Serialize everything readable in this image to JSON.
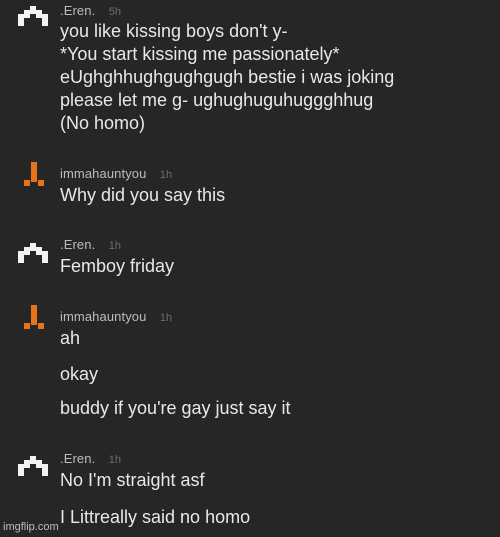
{
  "messages": [
    {
      "author": ".Eren.",
      "avatar_icon": "space-invader-icon",
      "time": "5h",
      "lines": [
        "you like kissing boys don't y-",
        "*You start kissing me passionately*",
        "eUghghhughgughgugh bestie i was joking",
        "please let me g- ughughuguhuggghhug",
        "(No homo)"
      ]
    },
    {
      "author": "immahauntyou",
      "avatar_icon": "orange-figure-icon",
      "time": "1h",
      "lines": [
        "Why did you say this"
      ]
    },
    {
      "author": ".Eren.",
      "avatar_icon": "space-invader-icon",
      "time": "1h",
      "lines": [
        "Femboy friday"
      ]
    },
    {
      "author": "immahauntyou",
      "avatar_icon": "orange-figure-icon",
      "time": "1h",
      "lines": [
        "ah",
        "okay",
        "buddy if you're gay just say it"
      ]
    },
    {
      "author": ".Eren.",
      "avatar_icon": "space-invader-icon",
      "time": "1h",
      "lines": [
        "No I'm straight asf",
        "I Littreally said no homo"
      ]
    }
  ],
  "watermark": "imgflip.com",
  "colors": {
    "background": "#262626",
    "text": "#e8e8e8",
    "username": "#bdbdbd",
    "timestamp": "#6e6e6e",
    "accent_orange": "#e8711c",
    "avatar_white": "#f2f2f2"
  }
}
